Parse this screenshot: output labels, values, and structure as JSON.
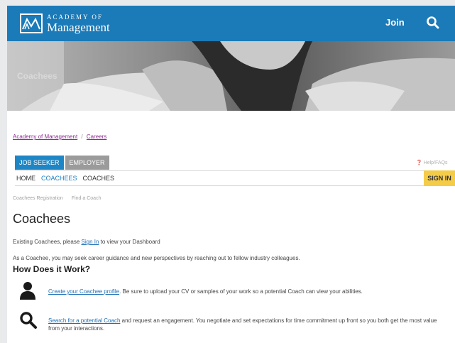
{
  "header": {
    "logo_small": "ACADEMY OF",
    "logo_big": "Management",
    "join_label": "Join"
  },
  "hero": {
    "label": "Coachees"
  },
  "breadcrumb": {
    "item1": "Academy of Management",
    "separator": "/",
    "item2": "Careers"
  },
  "tabs": {
    "job_seeker": "JOB SEEKER",
    "employer": "EMPLOYER"
  },
  "help_link": "Help/FAQs",
  "subnav": {
    "home": "HOME",
    "coachees": "COACHEES",
    "coaches": "COACHES",
    "sign_in": "SIGN IN"
  },
  "subsubnav": {
    "item1": "Coachees Registration",
    "item2": "Find a Coach"
  },
  "page": {
    "title": "Coachees",
    "existing_prefix": "Existing Coachees, please ",
    "existing_link": "Sign In",
    "existing_suffix": " to view your Dashboard",
    "intro": "As a Coachee, you may seek career guidance and new perspectives by reaching out to fellow industry colleagues.",
    "how_heading": "How Does it Work?"
  },
  "steps": [
    {
      "icon": "person-icon",
      "link": "Create your Coachee profile",
      "text": ". Be sure to upload your CV or samples of your work so a potential Coach can view your abilities."
    },
    {
      "icon": "search-icon",
      "link": "Search for a potential Coach",
      "text": " and request an engagement. You negotiate and set expectations for time commitment up front so you both get the most value from your interactions."
    }
  ],
  "colors": {
    "brand_blue": "#1b7ab8",
    "tab_blue": "#1f86c5",
    "tab_gray": "#9b9b9b",
    "sign_in_yellow": "#f5cc48",
    "link_purple": "#8b2d8e"
  }
}
